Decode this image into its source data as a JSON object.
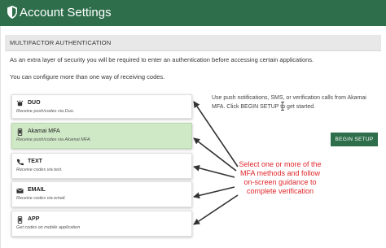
{
  "header": {
    "title": "Account Settings",
    "icon": "shield-icon",
    "color": "#2e6e4b"
  },
  "section": {
    "title": "MULTIFACTOR AUTHENTICATION"
  },
  "intro": {
    "line1": "As an extra layer of security you will be required to enter an authentication before accessing certain applications.",
    "line2": "You can configure more than one way of receiving codes."
  },
  "methods": [
    {
      "name": "DUO",
      "desc": "Receive push/codes via Duo.",
      "icon": "duo-icon",
      "selected": false
    },
    {
      "name": "Akamai MFA",
      "desc": "Receive push/codes via Akamai MFA.",
      "icon": "mobile-phone-icon",
      "selected": true
    },
    {
      "name": "TEXT",
      "desc": "Receive codes via text.",
      "icon": "sms-phone-icon",
      "selected": false
    },
    {
      "name": "EMAIL",
      "desc": "Receive codes via email.",
      "icon": "email-icon",
      "selected": false
    },
    {
      "name": "APP",
      "desc": "Get codes on mobile application",
      "icon": "app-icon",
      "selected": false
    }
  ],
  "info": {
    "text": "Use push notifications, SMS, or verification calls from Akamai MFA. Click BEGIN SETUP to get started."
  },
  "setup_button": {
    "label": "BEGIN SETUP"
  },
  "annotation": {
    "line1": "Select one or more of the",
    "line2": "MFA methods and follow",
    "line3": "on-screen guidance to",
    "line4": "complete verification",
    "color": "#e0262b"
  },
  "colors": {
    "accent": "#2e6e4b",
    "selected_bg": "#cfe8c6",
    "annotation": "#e0262b"
  }
}
